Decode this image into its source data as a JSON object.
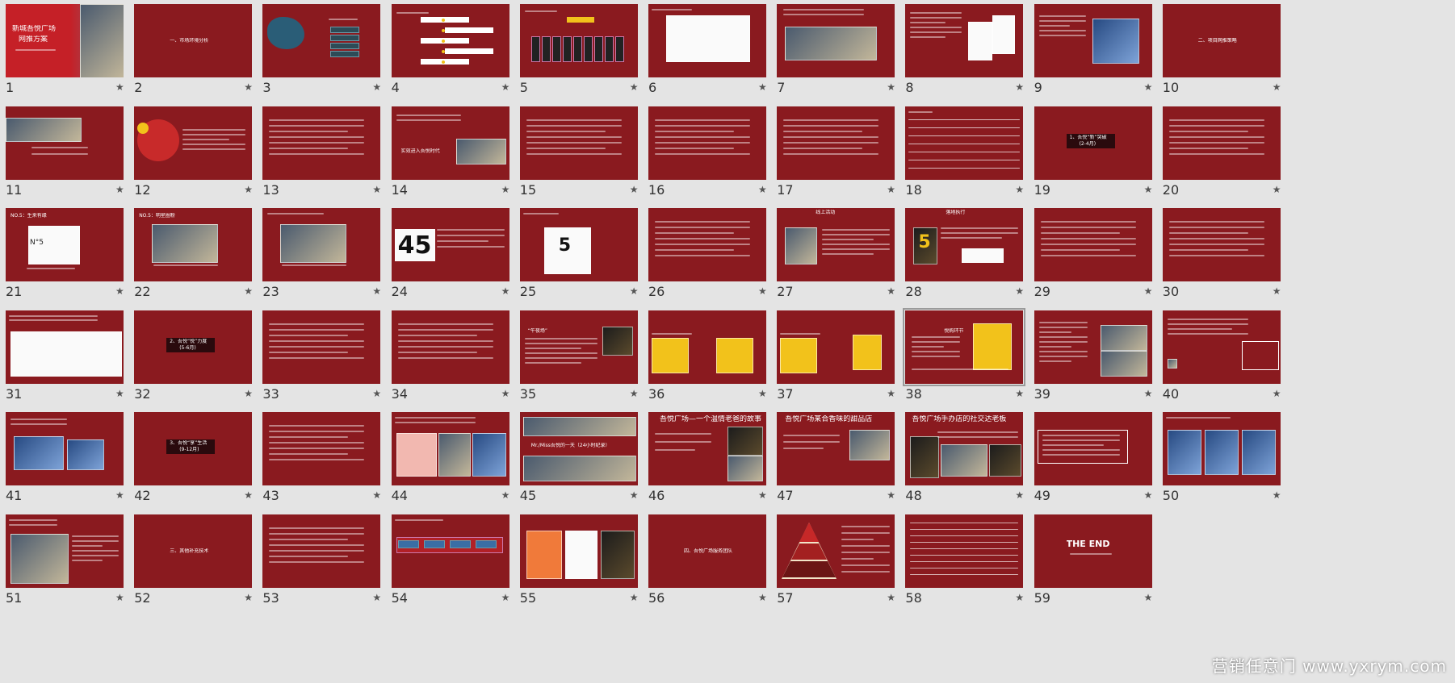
{
  "colors": {
    "background": "#e4e4e4",
    "slide": "#8a1a1f",
    "accent_yellow": "#f2c21b",
    "text": "#ffffff"
  },
  "star_icon": "star-icon",
  "slides": [
    {
      "n": "1",
      "kind": "cover",
      "lines": [
        "新城吾悦广场",
        "网推方案"
      ]
    },
    {
      "n": "2",
      "kind": "section",
      "lines": [
        "一、市场环境分析"
      ]
    },
    {
      "n": "3",
      "kind": "map",
      "lines": []
    },
    {
      "n": "4",
      "kind": "flow",
      "lines": []
    },
    {
      "n": "5",
      "kind": "org",
      "lines": []
    },
    {
      "n": "6",
      "kind": "logos",
      "lines": []
    },
    {
      "n": "7",
      "kind": "photo",
      "lines": []
    },
    {
      "n": "8",
      "kind": "phones",
      "lines": []
    },
    {
      "n": "9",
      "kind": "phone",
      "lines": []
    },
    {
      "n": "10",
      "kind": "section",
      "lines": [
        "二、项目网推策略"
      ]
    },
    {
      "n": "11",
      "kind": "photo-top",
      "lines": []
    },
    {
      "n": "12",
      "kind": "bubble",
      "lines": []
    },
    {
      "n": "13",
      "kind": "text",
      "lines": []
    },
    {
      "n": "14",
      "kind": "text-photo",
      "lines": [
        "实效进入吾悦时代"
      ]
    },
    {
      "n": "15",
      "kind": "text",
      "lines": []
    },
    {
      "n": "16",
      "kind": "text",
      "lines": []
    },
    {
      "n": "17",
      "kind": "text",
      "lines": []
    },
    {
      "n": "18",
      "kind": "table",
      "lines": []
    },
    {
      "n": "19",
      "kind": "badge",
      "lines": [
        "1、吾悦“新”突破",
        "(2-4月)"
      ]
    },
    {
      "n": "20",
      "kind": "text",
      "lines": []
    },
    {
      "n": "21",
      "kind": "perfume",
      "lines": [
        "NO.5：生来有缘",
        "N°5"
      ]
    },
    {
      "n": "22",
      "kind": "photo-mid",
      "lines": [
        "NO.5：明星圈粉"
      ]
    },
    {
      "n": "23",
      "kind": "photo-mid",
      "lines": []
    },
    {
      "n": "24",
      "kind": "digits",
      "lines": [
        "45"
      ]
    },
    {
      "n": "25",
      "kind": "calendar",
      "lines": [
        "5"
      ]
    },
    {
      "n": "26",
      "kind": "text",
      "lines": []
    },
    {
      "n": "27",
      "kind": "digits2",
      "lines": [
        "线上活动"
      ]
    },
    {
      "n": "28",
      "kind": "five",
      "lines": [
        "落地执行",
        "5"
      ]
    },
    {
      "n": "29",
      "kind": "text",
      "lines": []
    },
    {
      "n": "30",
      "kind": "text",
      "lines": []
    },
    {
      "n": "31",
      "kind": "collage",
      "lines": []
    },
    {
      "n": "32",
      "kind": "badge",
      "lines": [
        "2、吾悦“悦”力度",
        "(5-6月)"
      ]
    },
    {
      "n": "33",
      "kind": "text",
      "lines": []
    },
    {
      "n": "34",
      "kind": "text",
      "lines": [
        "“悦生活，悦无价！”"
      ]
    },
    {
      "n": "35",
      "kind": "text-photo2",
      "lines": [
        "“午夜场”"
      ]
    },
    {
      "n": "36",
      "kind": "yellow2",
      "lines": []
    },
    {
      "n": "37",
      "kind": "yellow2b",
      "lines": []
    },
    {
      "n": "38",
      "kind": "yellow1",
      "lines": [
        "悦购环节"
      ]
    },
    {
      "n": "39",
      "kind": "text-photo3",
      "lines": []
    },
    {
      "n": "40",
      "kind": "textbox",
      "lines": []
    },
    {
      "n": "41",
      "kind": "screens",
      "lines": []
    },
    {
      "n": "42",
      "kind": "badge",
      "lines": [
        "3、吾悦“享”生活",
        "(9-12月)"
      ]
    },
    {
      "n": "43",
      "kind": "text",
      "lines": []
    },
    {
      "n": "44",
      "kind": "cards",
      "lines": []
    },
    {
      "n": "45",
      "kind": "photostrip",
      "lines": [
        "Mr./Miss吾悦的一天（24小时纪录）"
      ]
    },
    {
      "n": "46",
      "kind": "story",
      "lines": [
        "吾悦广场—一个温情老爸的故事"
      ]
    },
    {
      "n": "47",
      "kind": "story2",
      "lines": [
        "吾悦广场某合香味的甜品店"
      ]
    },
    {
      "n": "48",
      "kind": "story3",
      "lines": [
        "吾悦广场手办店的社交达老板"
      ]
    },
    {
      "n": "49",
      "kind": "framebox",
      "lines": []
    },
    {
      "n": "50",
      "kind": "posters",
      "lines": []
    },
    {
      "n": "51",
      "kind": "hands",
      "lines": []
    },
    {
      "n": "52",
      "kind": "section",
      "lines": [
        "三、其他补充技术"
      ]
    },
    {
      "n": "53",
      "kind": "text",
      "lines": []
    },
    {
      "n": "54",
      "kind": "pipeline",
      "lines": []
    },
    {
      "n": "55",
      "kind": "screens2",
      "lines": []
    },
    {
      "n": "56",
      "kind": "section",
      "lines": [
        "四、吾悦广场服务团队"
      ]
    },
    {
      "n": "57",
      "kind": "pyramid",
      "lines": []
    },
    {
      "n": "58",
      "kind": "table2",
      "lines": []
    },
    {
      "n": "59",
      "kind": "end",
      "lines": [
        "THE END"
      ]
    }
  ],
  "watermark": "营销任意门 www.yxrym.com"
}
